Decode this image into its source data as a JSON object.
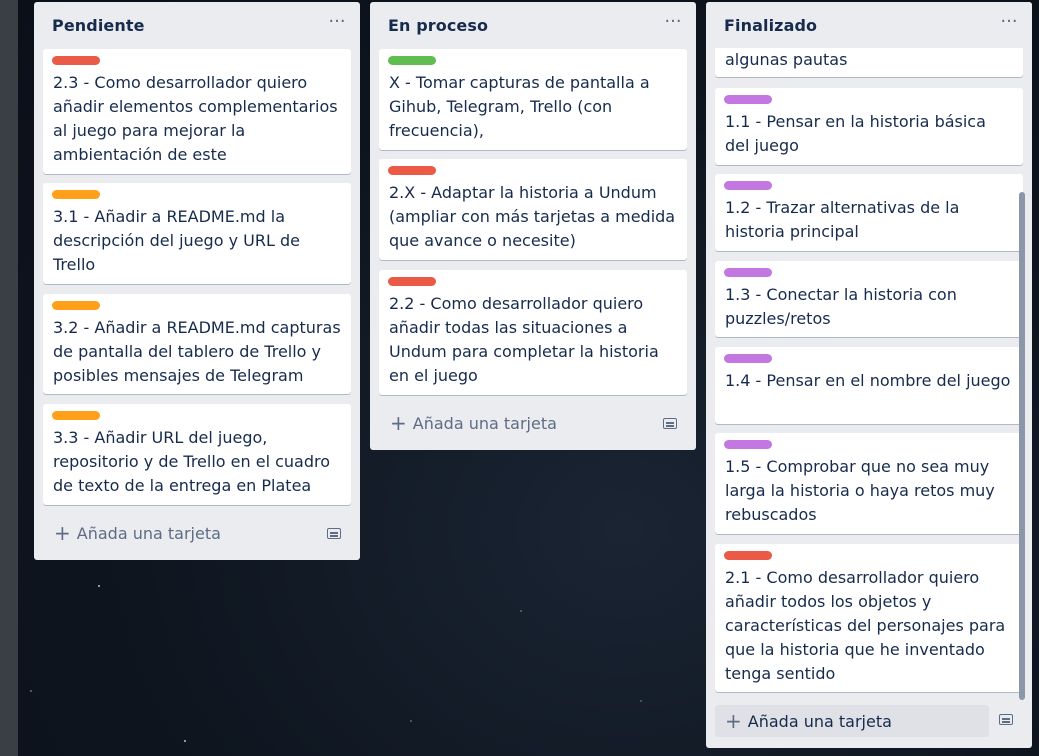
{
  "board": {
    "lists": [
      {
        "title": "Pendiente",
        "cards": [
          {
            "label_color": "#eb5a46",
            "text": "2.3 - Como desarrollador quiero añadir elementos complementarios al juego para mejorar la ambientación de este"
          },
          {
            "label_color": "#ff9f1a",
            "text": "3.1 - Añadir a README.md la descripción del juego y URL de Trello"
          },
          {
            "label_color": "#ff9f1a",
            "text": "3.2 - Añadir a README.md capturas de pantalla del tablero de Trello y posibles mensajes de Telegram"
          },
          {
            "label_color": "#ff9f1a",
            "text": "3.3 - Añadir URL del juego, repositorio y de Trello en el cuadro de texto de la entrega en Platea"
          }
        ],
        "add_card_label": "Añada una tarjeta",
        "menu_icon": "ellipsis-icon",
        "template_icon": "card-template-icon"
      },
      {
        "title": "En proceso",
        "cards": [
          {
            "label_color": "#61bd4f",
            "text": "X - Tomar capturas de pantalla a Gihub, Telegram, Trello (con frecuencia),"
          },
          {
            "label_color": "#eb5a46",
            "text": "2.X - Adaptar la historia a Undum (ampliar con más tarjetas a medida que avance o necesite)"
          },
          {
            "label_color": "#eb5a46",
            "text": "2.2 - Como desarrollador quiero añadir todas las situaciones a Undum para completar la historia en el juego"
          }
        ],
        "add_card_label": "Añada una tarjeta",
        "menu_icon": "ellipsis-icon",
        "template_icon": "card-template-icon"
      },
      {
        "title": "Finalizado",
        "cards": [
          {
            "label_color": "",
            "text": "algunas pautas"
          },
          {
            "label_color": "#c377e0",
            "text": "1.1 - Pensar en la historia básica del juego"
          },
          {
            "label_color": "#c377e0",
            "text": "1.2 - Trazar alternativas de la historia principal"
          },
          {
            "label_color": "#c377e0",
            "text": "1.3 - Conectar la historia con puzzles/retos"
          },
          {
            "label_color": "#c377e0",
            "text": "1.4 - Pensar en el nombre del juego"
          },
          {
            "label_color": "#c377e0",
            "text": "1.5 - Comprobar que no sea muy larga la historia o haya retos muy rebuscados"
          },
          {
            "label_color": "#eb5a46",
            "text": "2.1 - Como desarrollador quiero añadir todos los objetos y características del personajes para que la historia que he inventado tenga sentido"
          }
        ],
        "add_card_label": "Añada una tarjeta",
        "menu_icon": "ellipsis-icon",
        "template_icon": "card-template-icon"
      }
    ]
  }
}
